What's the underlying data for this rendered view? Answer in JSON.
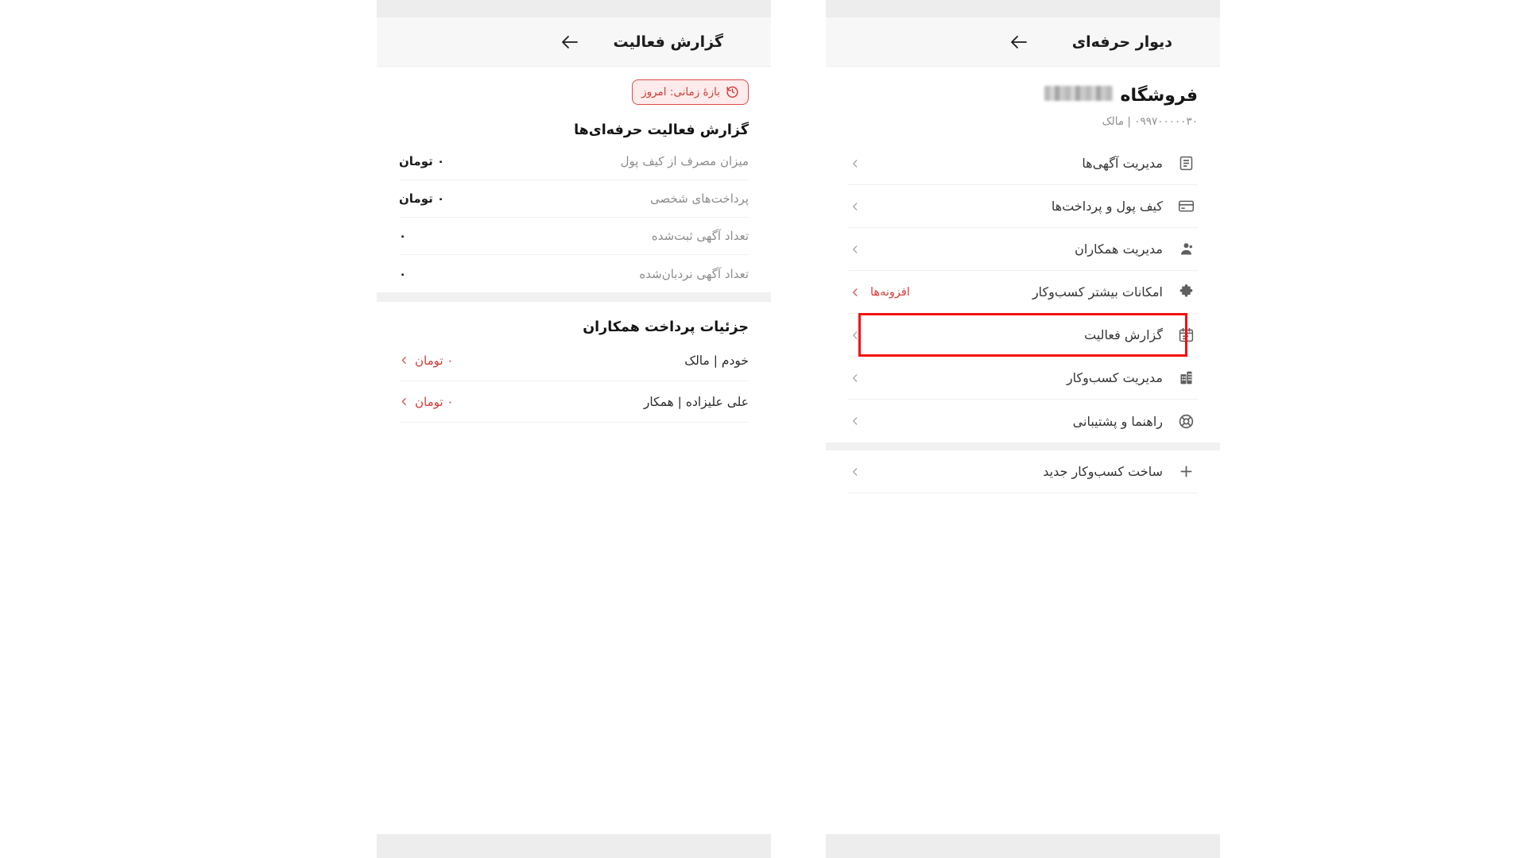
{
  "right_panel": {
    "app_bar": {
      "title": "دیوار حرفه‌ای",
      "back_icon": "arrow-left-icon"
    },
    "account": {
      "label": "فروشگاه",
      "name_redacted": true,
      "meta": "۰۹۹۷۰۰۰۰۰۳۰ | مالک"
    },
    "menu": [
      {
        "label": "مدیریت آگهی‌ها",
        "icon": "document-list-icon",
        "aside": "",
        "highlighted": false
      },
      {
        "label": "کیف پول و پرداخت‌ها",
        "icon": "credit-card-icon",
        "aside": "",
        "highlighted": false
      },
      {
        "label": "مدیریت همکاران",
        "icon": "user-person-icon",
        "aside": "",
        "highlighted": false
      },
      {
        "label": "امکانات بیشتر کسب‌وکار",
        "icon": "puzzle-piece-icon",
        "aside": "افزونه‌ها",
        "highlighted": false
      },
      {
        "label": "گزارش فعالیت",
        "icon": "calendar-icon",
        "aside": "",
        "highlighted": true
      },
      {
        "label": "مدیریت کسب‌وکار",
        "icon": "building-icon",
        "aside": "",
        "highlighted": false
      },
      {
        "label": "راهنما و پشتیبانی",
        "icon": "lifebuoy-icon",
        "aside": "",
        "highlighted": false
      }
    ],
    "menu_extra": [
      {
        "label": "ساخت کسب‌وکار جدید",
        "icon": "plus-icon",
        "aside": "",
        "highlighted": false
      }
    ]
  },
  "left_panel": {
    "app_bar": {
      "title": "گزارش فعالیت",
      "back_icon": "arrow-left-icon"
    },
    "time_chip": {
      "label": "بازهٔ زمانی: امروز",
      "icon": "clock-history-icon",
      "border_color": "#e04a47",
      "background_color": "#fdeceb",
      "text_color": "#cf3b38"
    },
    "activity_card": {
      "title": "گزارش فعالیت حرفه‌ای‌ها",
      "rows": [
        {
          "label": "میزان مصرف از کیف پول",
          "value": "۰ تومان"
        },
        {
          "label": "پرداخت‌های شخصی",
          "value": "۰ تومان"
        },
        {
          "label": "تعداد آگهی ثبت‌شده",
          "value": "۰"
        },
        {
          "label": "تعداد آگهی نردبان‌شده",
          "value": "۰"
        }
      ]
    },
    "payments_card": {
      "title": "جزئیات پرداخت همکاران",
      "rows": [
        {
          "name": "خودم | مالک",
          "amount": "۰ تومان",
          "chevron": "chevron-left-icon"
        },
        {
          "name": "علی علیزاده | همکار",
          "amount": "۰ تومان",
          "chevron": "chevron-left-icon"
        }
      ]
    }
  },
  "annotation": {
    "highlight_color": "#f50f0f",
    "target": "گزارش فعالیت"
  }
}
